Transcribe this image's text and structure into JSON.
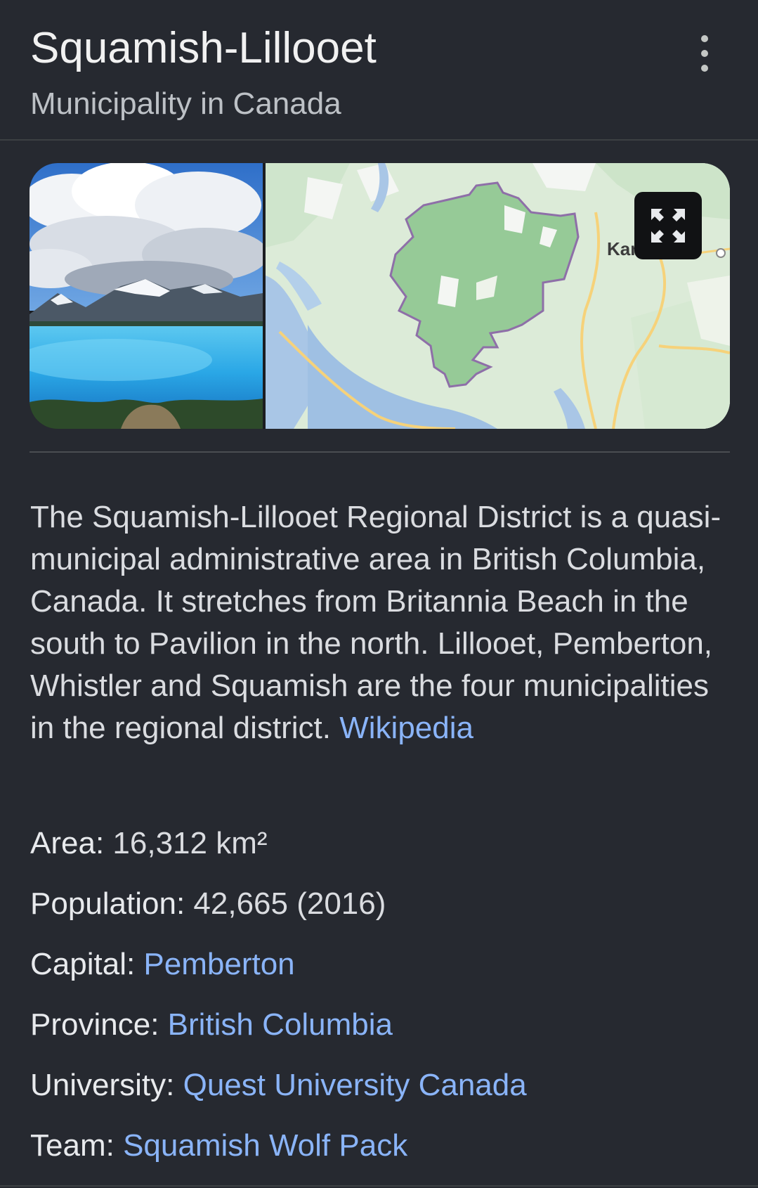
{
  "header": {
    "title": "Squamish-Lillooet",
    "subtitle": "Municipality in Canada",
    "more_icon": "more-vert-icon"
  },
  "media": {
    "map_label": "Kamloops",
    "expand_icon": "fullscreen-icon"
  },
  "description": {
    "text": "The Squamish-Lillooet Regional District is a quasi-municipal administrative area in British Columbia, Canada. It stretches from Britannia Beach in the south to Pavilion in the north. Lillooet, Pemberton, Whistler and Squamish are the four municipalities in the regional district.",
    "source_link": "Wikipedia"
  },
  "facts": [
    {
      "label": "Area:",
      "value": "16,312 km²",
      "is_link": false
    },
    {
      "label": "Population:",
      "value": "42,665 (2016)",
      "is_link": false
    },
    {
      "label": "Capital:",
      "value": "Pemberton",
      "is_link": true
    },
    {
      "label": "Province:",
      "value": "British Columbia",
      "is_link": true
    },
    {
      "label": "University:",
      "value": "Quest University Canada",
      "is_link": true
    },
    {
      "label": "Team:",
      "value": "Squamish Wolf Pack",
      "is_link": true
    }
  ],
  "colors": {
    "background": "#262930",
    "link": "#8ab4f8",
    "text": "#dadce0",
    "subtitle": "#bdc1c6"
  }
}
